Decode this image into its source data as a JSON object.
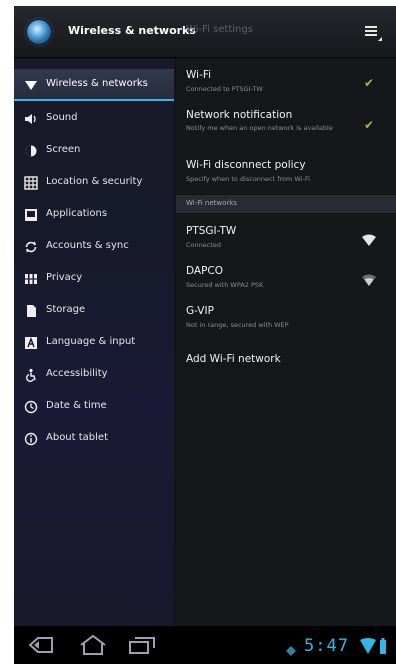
{
  "action_bar": {
    "breadcrumb_active": "Wireless & networks",
    "breadcrumb_inactive": "Wi-Fi settings",
    "app_icon": "settings-app-icon",
    "overflow_icon": "overflow-menu-icon"
  },
  "sidebar": {
    "items": [
      {
        "label": "Wireless & networks",
        "icon": "wifi-icon",
        "selected": true
      },
      {
        "label": "Sound",
        "icon": "speaker-icon",
        "selected": false
      },
      {
        "label": "Screen",
        "icon": "brightness-icon",
        "selected": false
      },
      {
        "label": "Location & security",
        "icon": "grid-lock-icon",
        "selected": false
      },
      {
        "label": "Applications",
        "icon": "applications-icon",
        "selected": false
      },
      {
        "label": "Accounts & sync",
        "icon": "sync-icon",
        "selected": false
      },
      {
        "label": "Privacy",
        "icon": "privacy-icon",
        "selected": false
      },
      {
        "label": "Storage",
        "icon": "storage-icon",
        "selected": false
      },
      {
        "label": "Language & input",
        "icon": "language-icon",
        "selected": false
      },
      {
        "label": "Accessibility",
        "icon": "accessibility-icon",
        "selected": false
      },
      {
        "label": "Date & time",
        "icon": "clock-icon",
        "selected": false
      },
      {
        "label": "About tablet",
        "icon": "info-icon",
        "selected": false
      }
    ]
  },
  "wifi_settings": {
    "wifi": {
      "title": "Wi-Fi",
      "summary": "Connected to PTSGI-TW",
      "checked": true
    },
    "notification": {
      "title": "Network notification",
      "summary": "Notify me when an open network is available",
      "checked": true
    },
    "disconnect_policy": {
      "title": "Wi-Fi disconnect policy",
      "summary": "Specify when to disconnect from Wi-Fi"
    },
    "networks_header": "Wi-Fi networks",
    "networks": [
      {
        "ssid": "PTSGI-TW",
        "status": "Connected",
        "signal_icon": "wifi-signal-strong-icon"
      },
      {
        "ssid": "DAPCO",
        "status": "Secured with WPA2 PSK",
        "signal_icon": "wifi-signal-locked-icon"
      },
      {
        "ssid": "G-VIP",
        "status": "Not in range, secured with WEP",
        "signal_icon": ""
      }
    ],
    "add_network": "Add Wi-Fi network"
  },
  "system_bar": {
    "clock": "5:47",
    "back_icon": "back-icon",
    "home_icon": "home-icon",
    "recents_icon": "recent-apps-icon",
    "notification_icon": "notification-icon",
    "status_icons": "wifi-battery-icon",
    "accent": "#33b5e5"
  }
}
